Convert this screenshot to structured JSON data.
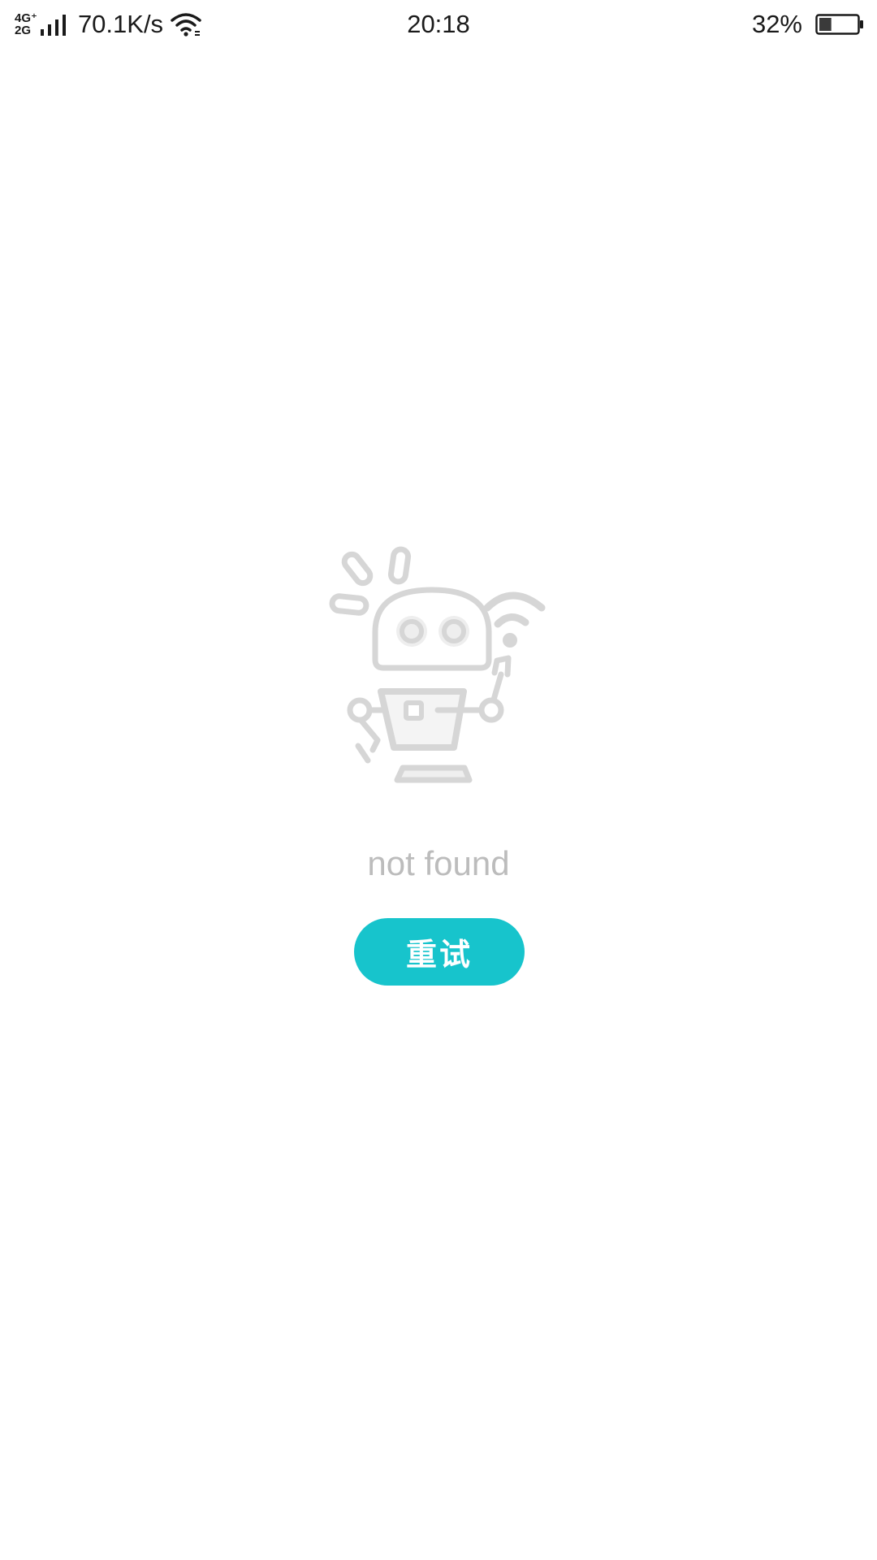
{
  "status_bar": {
    "network_type_top": "4G⁺",
    "network_type_bottom": "2G",
    "net_speed": "70.1K/s",
    "time": "20:18",
    "battery_percent": "32%",
    "battery_level": 0.32,
    "icons": [
      "signal-icon",
      "wifi-icon",
      "battery-icon"
    ]
  },
  "error_state": {
    "illustration": "robot-icon",
    "message": "not found",
    "retry_label": "重试",
    "accent_color": "#17c4cc"
  }
}
